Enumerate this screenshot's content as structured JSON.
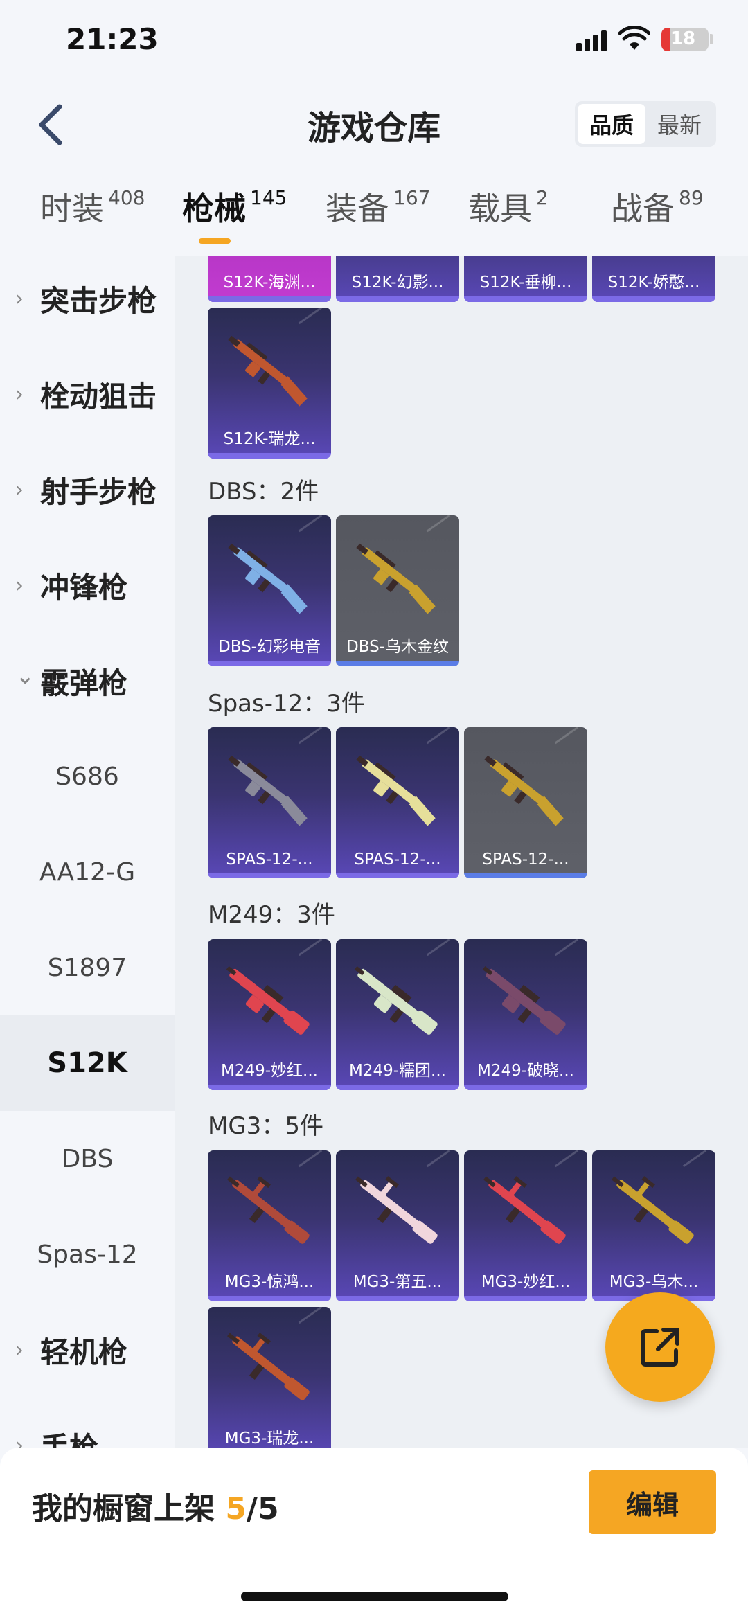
{
  "status_bar": {
    "time": "21:23",
    "battery": "18"
  },
  "header": {
    "title": "游戏仓库",
    "sort_options": [
      "品质",
      "最新"
    ],
    "active_sort": "品质"
  },
  "tabs": [
    {
      "label": "时装",
      "count": "408"
    },
    {
      "label": "枪械",
      "count": "145",
      "active": true
    },
    {
      "label": "装备",
      "count": "167"
    },
    {
      "label": "载具",
      "count": "2"
    },
    {
      "label": "战备",
      "count": "89"
    }
  ],
  "sidebar": {
    "items": [
      {
        "label": "突击步枪",
        "type": "group"
      },
      {
        "label": "栓动狙击",
        "type": "group"
      },
      {
        "label": "射手步枪",
        "type": "group"
      },
      {
        "label": "冲锋枪",
        "type": "group"
      },
      {
        "label": "霰弹枪",
        "type": "group-open"
      },
      {
        "label": "S686",
        "type": "sub"
      },
      {
        "label": "AA12-G",
        "type": "sub"
      },
      {
        "label": "S1897",
        "type": "sub"
      },
      {
        "label": "S12K",
        "type": "sub",
        "selected": true
      },
      {
        "label": "DBS",
        "type": "sub"
      },
      {
        "label": "Spas-12",
        "type": "sub"
      },
      {
        "label": "轻机枪",
        "type": "group"
      },
      {
        "label": "手枪",
        "type": "group"
      }
    ]
  },
  "sections": [
    {
      "title": "",
      "items": [
        {
          "name": "S12K-海渊...",
          "rarity": "magenta",
          "icon": "shotgun-skin"
        },
        {
          "name": "S12K-幻影...",
          "rarity": "purple",
          "icon": "shotgun-skin"
        },
        {
          "name": "S12K-垂柳...",
          "rarity": "purple",
          "icon": "shotgun-skin"
        },
        {
          "name": "S12K-娇憨...",
          "rarity": "purple",
          "icon": "shotgun-skin"
        },
        {
          "name": "S12K-瑞龙...",
          "rarity": "purple",
          "icon": "shotgun-skin",
          "color": "#c0572f"
        }
      ]
    },
    {
      "title": "DBS：2件",
      "items": [
        {
          "name": "DBS-幻彩电音",
          "rarity": "purple",
          "icon": "shotgun-skin",
          "color": "#7fb0e6"
        },
        {
          "name": "DBS-乌木金纹",
          "rarity": "gray",
          "icon": "shotgun-skin",
          "color": "#c9a12e"
        }
      ]
    },
    {
      "title": "Spas-12：3件",
      "items": [
        {
          "name": "SPAS-12-...",
          "rarity": "purple",
          "icon": "shotgun-skin",
          "color": "#8a8a9a"
        },
        {
          "name": "SPAS-12-...",
          "rarity": "purple",
          "icon": "shotgun-skin",
          "color": "#e6df9a"
        },
        {
          "name": "SPAS-12-...",
          "rarity": "gray",
          "icon": "shotgun-skin",
          "color": "#c9a12e"
        }
      ]
    },
    {
      "title": "M249：3件",
      "items": [
        {
          "name": "M249-妙红...",
          "rarity": "purple",
          "icon": "lmg-skin",
          "color": "#e0454f"
        },
        {
          "name": "M249-糯团...",
          "rarity": "purple",
          "icon": "lmg-skin",
          "color": "#d8e6c8"
        },
        {
          "name": "M249-破晓...",
          "rarity": "purple",
          "icon": "lmg-skin",
          "color": "#7a4a6a"
        }
      ]
    },
    {
      "title": "MG3：5件",
      "items": [
        {
          "name": "MG3-惊鸿...",
          "rarity": "purple",
          "icon": "mg-skin",
          "color": "#b04a3a"
        },
        {
          "name": "MG3-第五...",
          "rarity": "purple",
          "icon": "mg-skin",
          "color": "#f1d6dc"
        },
        {
          "name": "MG3-妙红...",
          "rarity": "purple",
          "icon": "mg-skin",
          "color": "#e0454f"
        },
        {
          "name": "MG3-乌木...",
          "rarity": "purple",
          "icon": "mg-skin",
          "color": "#c9a12e"
        },
        {
          "name": "MG3-瑞龙...",
          "rarity": "purple",
          "icon": "mg-skin",
          "color": "#c0572f"
        }
      ]
    }
  ],
  "showcase": {
    "label": "我的橱窗上架",
    "current": "5",
    "total": "/5"
  },
  "edit_label": "编辑",
  "colors": {
    "accent": "#f5a623",
    "card_purple": "#3a3470",
    "card_gray": "#5a5c64",
    "card_magenta": "#b632c4"
  }
}
